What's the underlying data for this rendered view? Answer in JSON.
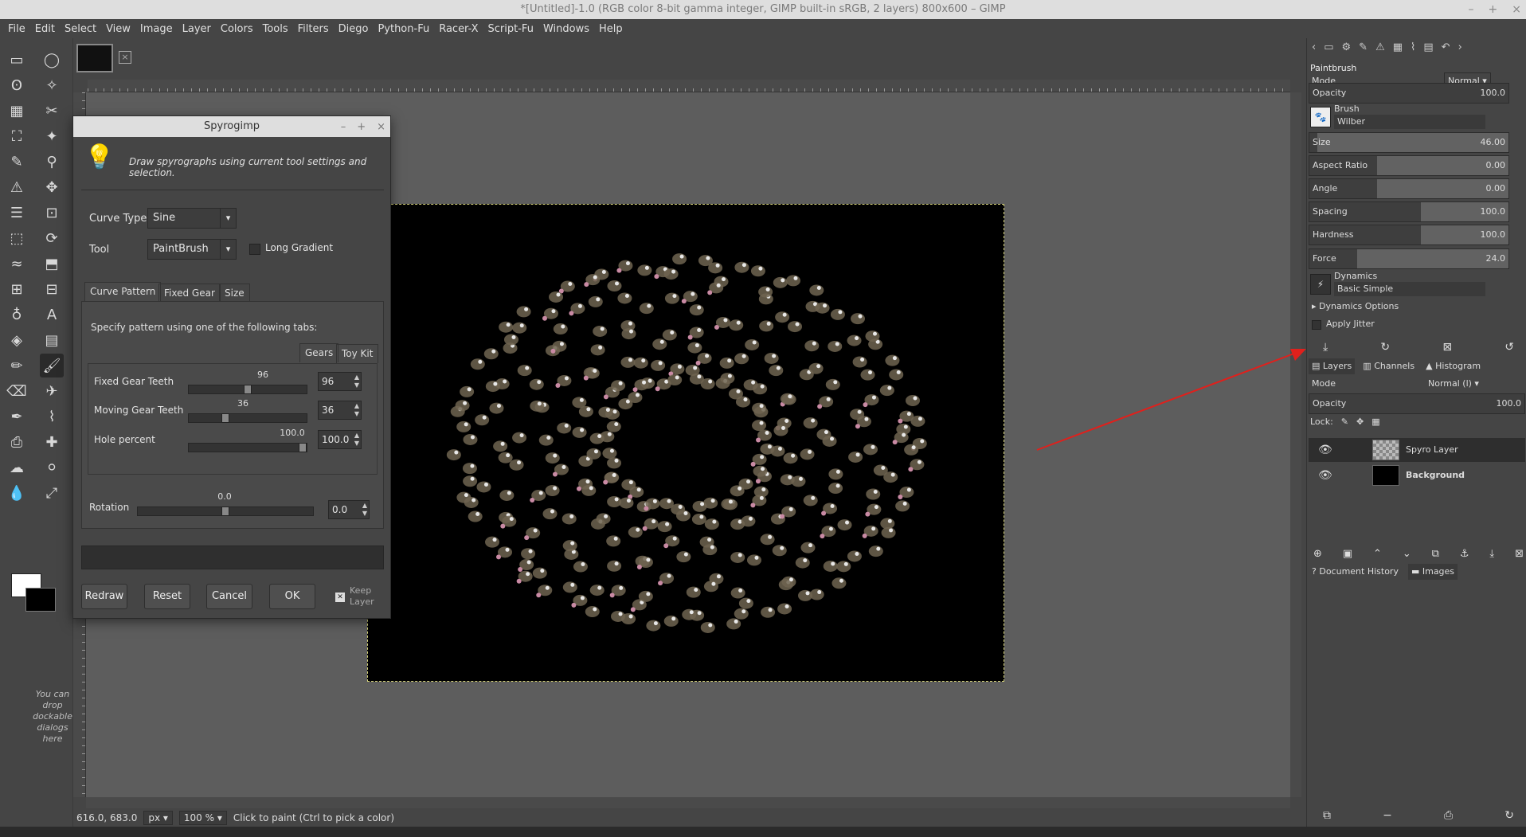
{
  "window": {
    "title": "*[Untitled]-1.0 (RGB color 8-bit gamma integer, GIMP built-in sRGB, 2 layers) 800x600 – GIMP",
    "controls": [
      "–",
      "+",
      "×"
    ]
  },
  "menu": [
    "File",
    "Edit",
    "Select",
    "View",
    "Image",
    "Layer",
    "Colors",
    "Tools",
    "Filters",
    "Diego",
    "Python-Fu",
    "Racer-X",
    "Script-Fu",
    "Windows",
    "Help"
  ],
  "toolbox": {
    "drop_hint": "You can drop dockable dialogs here",
    "tools": [
      "rect-select-icon",
      "ellipse-select-icon",
      "lasso-icon",
      "magic-wand-icon",
      "by-color-select-icon",
      "scissors-icon",
      "foreground-select-icon",
      "fuzzy-select-icon",
      "color-picker-icon",
      "zoom-icon",
      "measure-icon",
      "move-icon",
      "align-icon",
      "crop-icon",
      "unified-transform-icon",
      "rotate-icon",
      "warp-icon",
      "perspective-icon",
      "cage-icon",
      "3d-transform-icon",
      "path-icon",
      "text-icon",
      "bucket-fill-icon",
      "gradient-icon",
      "pencil-icon",
      "paintbrush-icon",
      "eraser-icon",
      "airbrush-icon",
      "ink-icon",
      "mypaint-brush-icon",
      "clone-icon",
      "heal-icon",
      "smudge-icon",
      "dodge-icon",
      "blur-icon",
      "perspective-clone-icon"
    ],
    "tool_glyphs": [
      "▭",
      "◯",
      "ʘ",
      "✧",
      "▦",
      "✂",
      "⛶",
      "✦",
      "✎",
      "⚲",
      "⚠",
      "✥",
      "☰",
      "⊡",
      "⬚",
      "⟳",
      "≈",
      "⬒",
      "⊞",
      "⊟",
      "♁",
      "A",
      "◈",
      "▤",
      "✏",
      "🖌",
      "⌫",
      "✈",
      "✒",
      "⌇",
      "⎙",
      "✚",
      "☁",
      "⚪",
      "💧",
      "⤢"
    ],
    "active_tool_index": 25
  },
  "statusbar": {
    "coords": "616.0, 683.0",
    "unit": "px",
    "zoom": "100 %",
    "message": "Click to paint (Ctrl to pick a color)"
  },
  "dialog": {
    "title": "Spyrogimp",
    "description": "Draw spyrographs using current tool settings and selection.",
    "curve_type_label": "Curve Type",
    "curve_type_value": "Sine",
    "tool_label": "Tool",
    "tool_value": "PaintBrush",
    "long_gradient_label": "Long Gradient",
    "tabs": [
      "Curve Pattern",
      "Fixed Gear",
      "Size"
    ],
    "pattern_hint": "Specify pattern using one of the following tabs:",
    "subtabs": [
      "Gears",
      "Toy Kit"
    ],
    "fixed_gear_label": "Fixed Gear Teeth",
    "fixed_gear_value": "96",
    "fixed_gear_level": 0.5,
    "moving_gear_label": "Moving Gear Teeth",
    "moving_gear_value": "36",
    "moving_gear_level": 0.3,
    "hole_label": "Hole percent",
    "hole_value": "100.0",
    "hole_level": 1.0,
    "rotation_label": "Rotation",
    "rotation_value": "0.0",
    "rotation_level": 0.5,
    "buttons": [
      "Redraw",
      "Reset",
      "Cancel",
      "OK"
    ],
    "keep_layer_label": "Keep Layer"
  },
  "tool_options": {
    "title": "Paintbrush",
    "mode_label": "Mode",
    "mode_value": "Normal",
    "opacity_label": "Opacity",
    "opacity_value": "100.0",
    "brush_label": "Brush",
    "brush_value": "Wilber",
    "size_label": "Size",
    "size_value": "46.00",
    "aspect_label": "Aspect Ratio",
    "aspect_value": "0.00",
    "angle_label": "Angle",
    "angle_value": "0.00",
    "spacing_label": "Spacing",
    "spacing_value": "100.0",
    "hardness_label": "Hardness",
    "hardness_value": "100.0",
    "force_label": "Force",
    "force_value": "24.0",
    "dynamics_label": "Dynamics",
    "dynamics_value": "Basic Simple",
    "dynamics_options_label": "Dynamics Options",
    "apply_jitter_label": "Apply Jitter"
  },
  "layers_panel": {
    "tabs": [
      "Layers",
      "Channels",
      "Histogram"
    ],
    "mode_label": "Mode",
    "mode_value": "Normal (l)",
    "opacity_label": "Opacity",
    "opacity_value": "100.0",
    "lock_label": "Lock:",
    "layers": [
      "Spyro Layer",
      "Background"
    ]
  },
  "bottom_tabs": [
    "Document History",
    "Images"
  ],
  "colors": {
    "accent_arrow": "#e0201c",
    "canvas_bg": "#000000",
    "selection": "#d6d47a"
  }
}
